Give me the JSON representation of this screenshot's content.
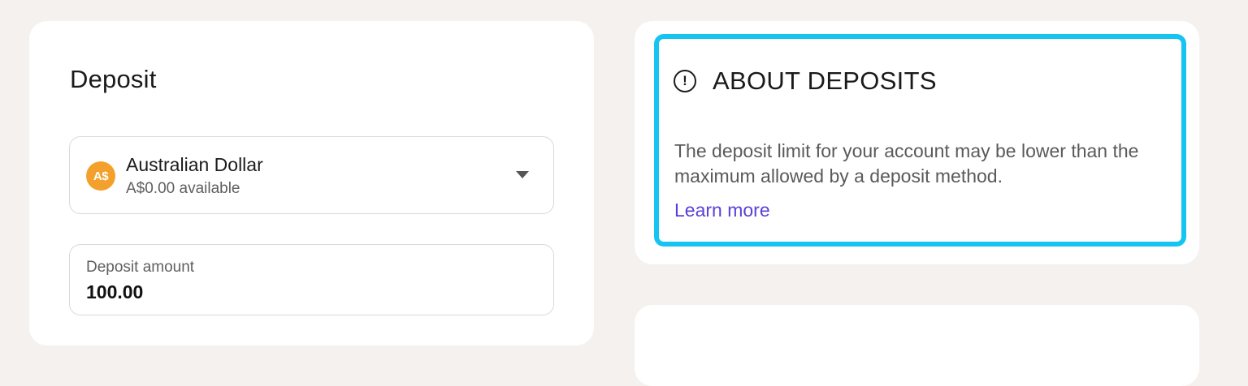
{
  "deposit": {
    "title": "Deposit",
    "currency": {
      "icon_symbol": "A$",
      "icon_color": "#f3a12c",
      "name": "Australian Dollar",
      "balance": "A$0.00 available"
    },
    "amount": {
      "label": "Deposit amount",
      "value": "100.00"
    }
  },
  "about": {
    "icon": "info-icon",
    "icon_glyph": "!",
    "title": "ABOUT DEPOSITS",
    "description": "The deposit limit for your account may be lower than the maximum allowed by a deposit method.",
    "link_label": "Learn more",
    "link_color": "#5b3fd8",
    "highlight_color": "#16c4f1"
  },
  "theme": {
    "background": "#f5f1ee",
    "card": "#ffffff"
  }
}
